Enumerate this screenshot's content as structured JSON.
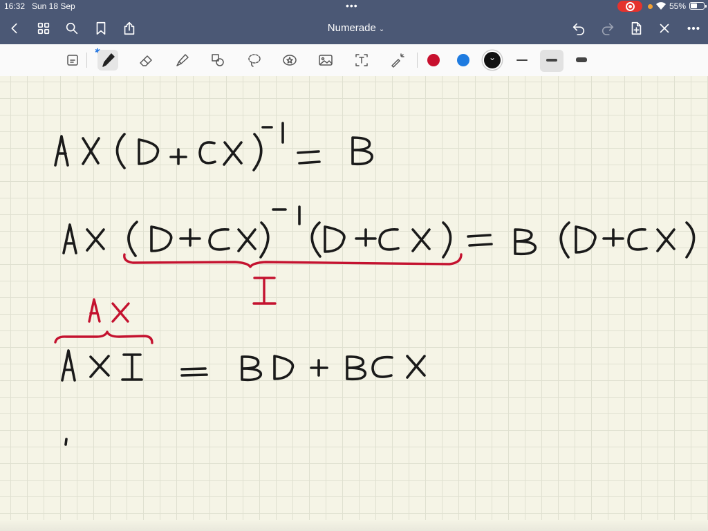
{
  "status": {
    "time": "16:32",
    "date": "Sun 18 Sep",
    "battery": "55%",
    "battery_level": 0.55
  },
  "nav": {
    "title": "Numerade",
    "title_chevron": "⌄"
  },
  "toolbar": {
    "colors": [
      "#c8102e",
      "#1e7be0",
      "#111111"
    ],
    "selected_color": "#111111"
  },
  "note": {
    "lines": [
      "AX(D+CX)⁻¹ = B",
      "AX(D+CX)⁻¹(D+CX) = B(D+CX)",
      "I",
      "AX",
      "AXI = BD+BCX"
    ],
    "ink_colors": {
      "black": "#1a1a1a",
      "red": "#c4122f"
    }
  }
}
